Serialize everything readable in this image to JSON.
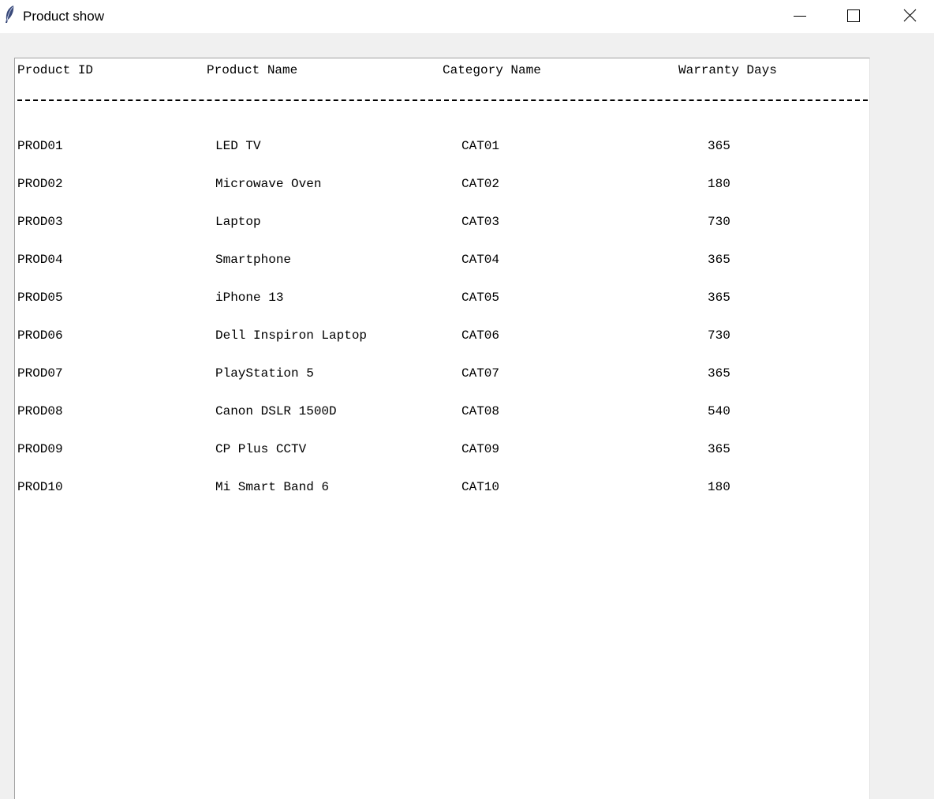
{
  "window": {
    "title": "Product show",
    "app_icon": "feather-icon",
    "controls": [
      "minimize-icon",
      "maximize-icon",
      "close-icon"
    ]
  },
  "table": {
    "headers": {
      "product_id": "Product ID",
      "product_name": "Product Name",
      "category_name": "Category Name",
      "warranty_days": "Warranty Days"
    },
    "separator": "------------------------------------------------------------------------------------------",
    "rows": [
      {
        "id": "PROD01",
        "name": "LED TV",
        "category": "CAT01",
        "warranty": "365"
      },
      {
        "id": "PROD02",
        "name": "Microwave Oven",
        "category": "CAT02",
        "warranty": "180"
      },
      {
        "id": "PROD03",
        "name": "Laptop",
        "category": "CAT03",
        "warranty": "730"
      },
      {
        "id": "PROD04",
        "name": "Smartphone",
        "category": "CAT04",
        "warranty": "365"
      },
      {
        "id": "PROD05",
        "name": "iPhone 13",
        "category": "CAT05",
        "warranty": "365"
      },
      {
        "id": "PROD06",
        "name": "Dell Inspiron Laptop",
        "category": "CAT06",
        "warranty": "730"
      },
      {
        "id": "PROD07",
        "name": "PlayStation 5",
        "category": "CAT07",
        "warranty": "365"
      },
      {
        "id": "PROD08",
        "name": "Canon DSLR 1500D",
        "category": "CAT08",
        "warranty": "540"
      },
      {
        "id": "PROD09",
        "name": "CP Plus CCTV",
        "category": "CAT09",
        "warranty": "365"
      },
      {
        "id": "PROD10",
        "name": "Mi Smart Band 6",
        "category": "CAT10",
        "warranty": "180"
      }
    ]
  }
}
